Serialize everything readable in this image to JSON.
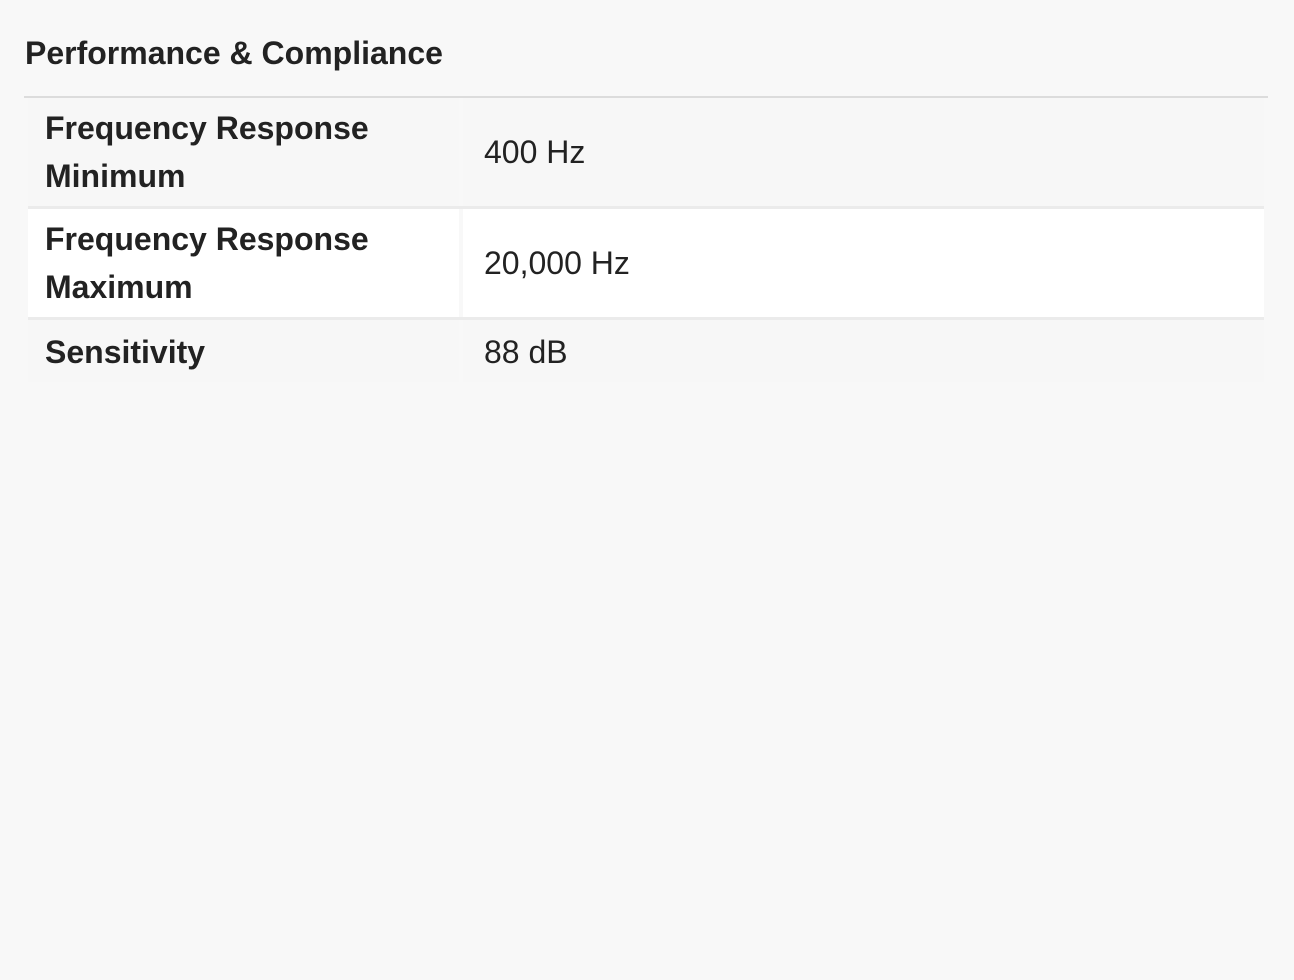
{
  "section": {
    "title": "Performance & Compliance"
  },
  "specs": [
    {
      "label": "Frequency Response Minimum",
      "value": "400 Hz"
    },
    {
      "label": "Frequency Response Maximum",
      "value": "20,000 Hz"
    },
    {
      "label": "Sensitivity",
      "value": "88 dB"
    }
  ]
}
